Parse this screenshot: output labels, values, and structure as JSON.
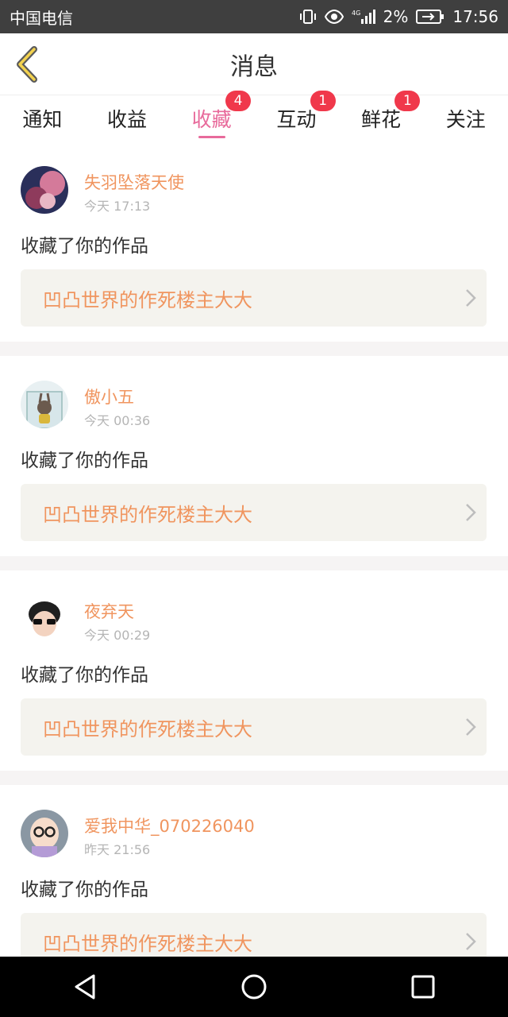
{
  "status": {
    "carrier": "中国电信",
    "battery": "2%",
    "time": "17:56",
    "network": "4G"
  },
  "header": {
    "title": "消息"
  },
  "tabs": [
    {
      "label": "通知",
      "badge": ""
    },
    {
      "label": "收益",
      "badge": ""
    },
    {
      "label": "收藏",
      "badge": "4"
    },
    {
      "label": "互动",
      "badge": "1"
    },
    {
      "label": "鲜花",
      "badge": "1"
    },
    {
      "label": "关注",
      "badge": ""
    }
  ],
  "active_tab": "收藏",
  "messages": [
    {
      "user": "失羽坠落天使",
      "time": "今天 17:13",
      "action": "收藏了你的作品",
      "work": "凹凸世界的作死楼主大大"
    },
    {
      "user": "傲小五",
      "time": "今天 00:36",
      "action": "收藏了你的作品",
      "work": "凹凸世界的作死楼主大大"
    },
    {
      "user": "夜弃天",
      "time": "今天 00:29",
      "action": "收藏了你的作品",
      "work": "凹凸世界的作死楼主大大"
    },
    {
      "user": "爱我中华_070226040",
      "time": "昨天 21:56",
      "action": "收藏了你的作品",
      "work": "凹凸世界的作死楼主大大"
    }
  ],
  "colors": {
    "accent": "#e86a9b",
    "badge": "#f0384b",
    "name": "#f0955f"
  }
}
